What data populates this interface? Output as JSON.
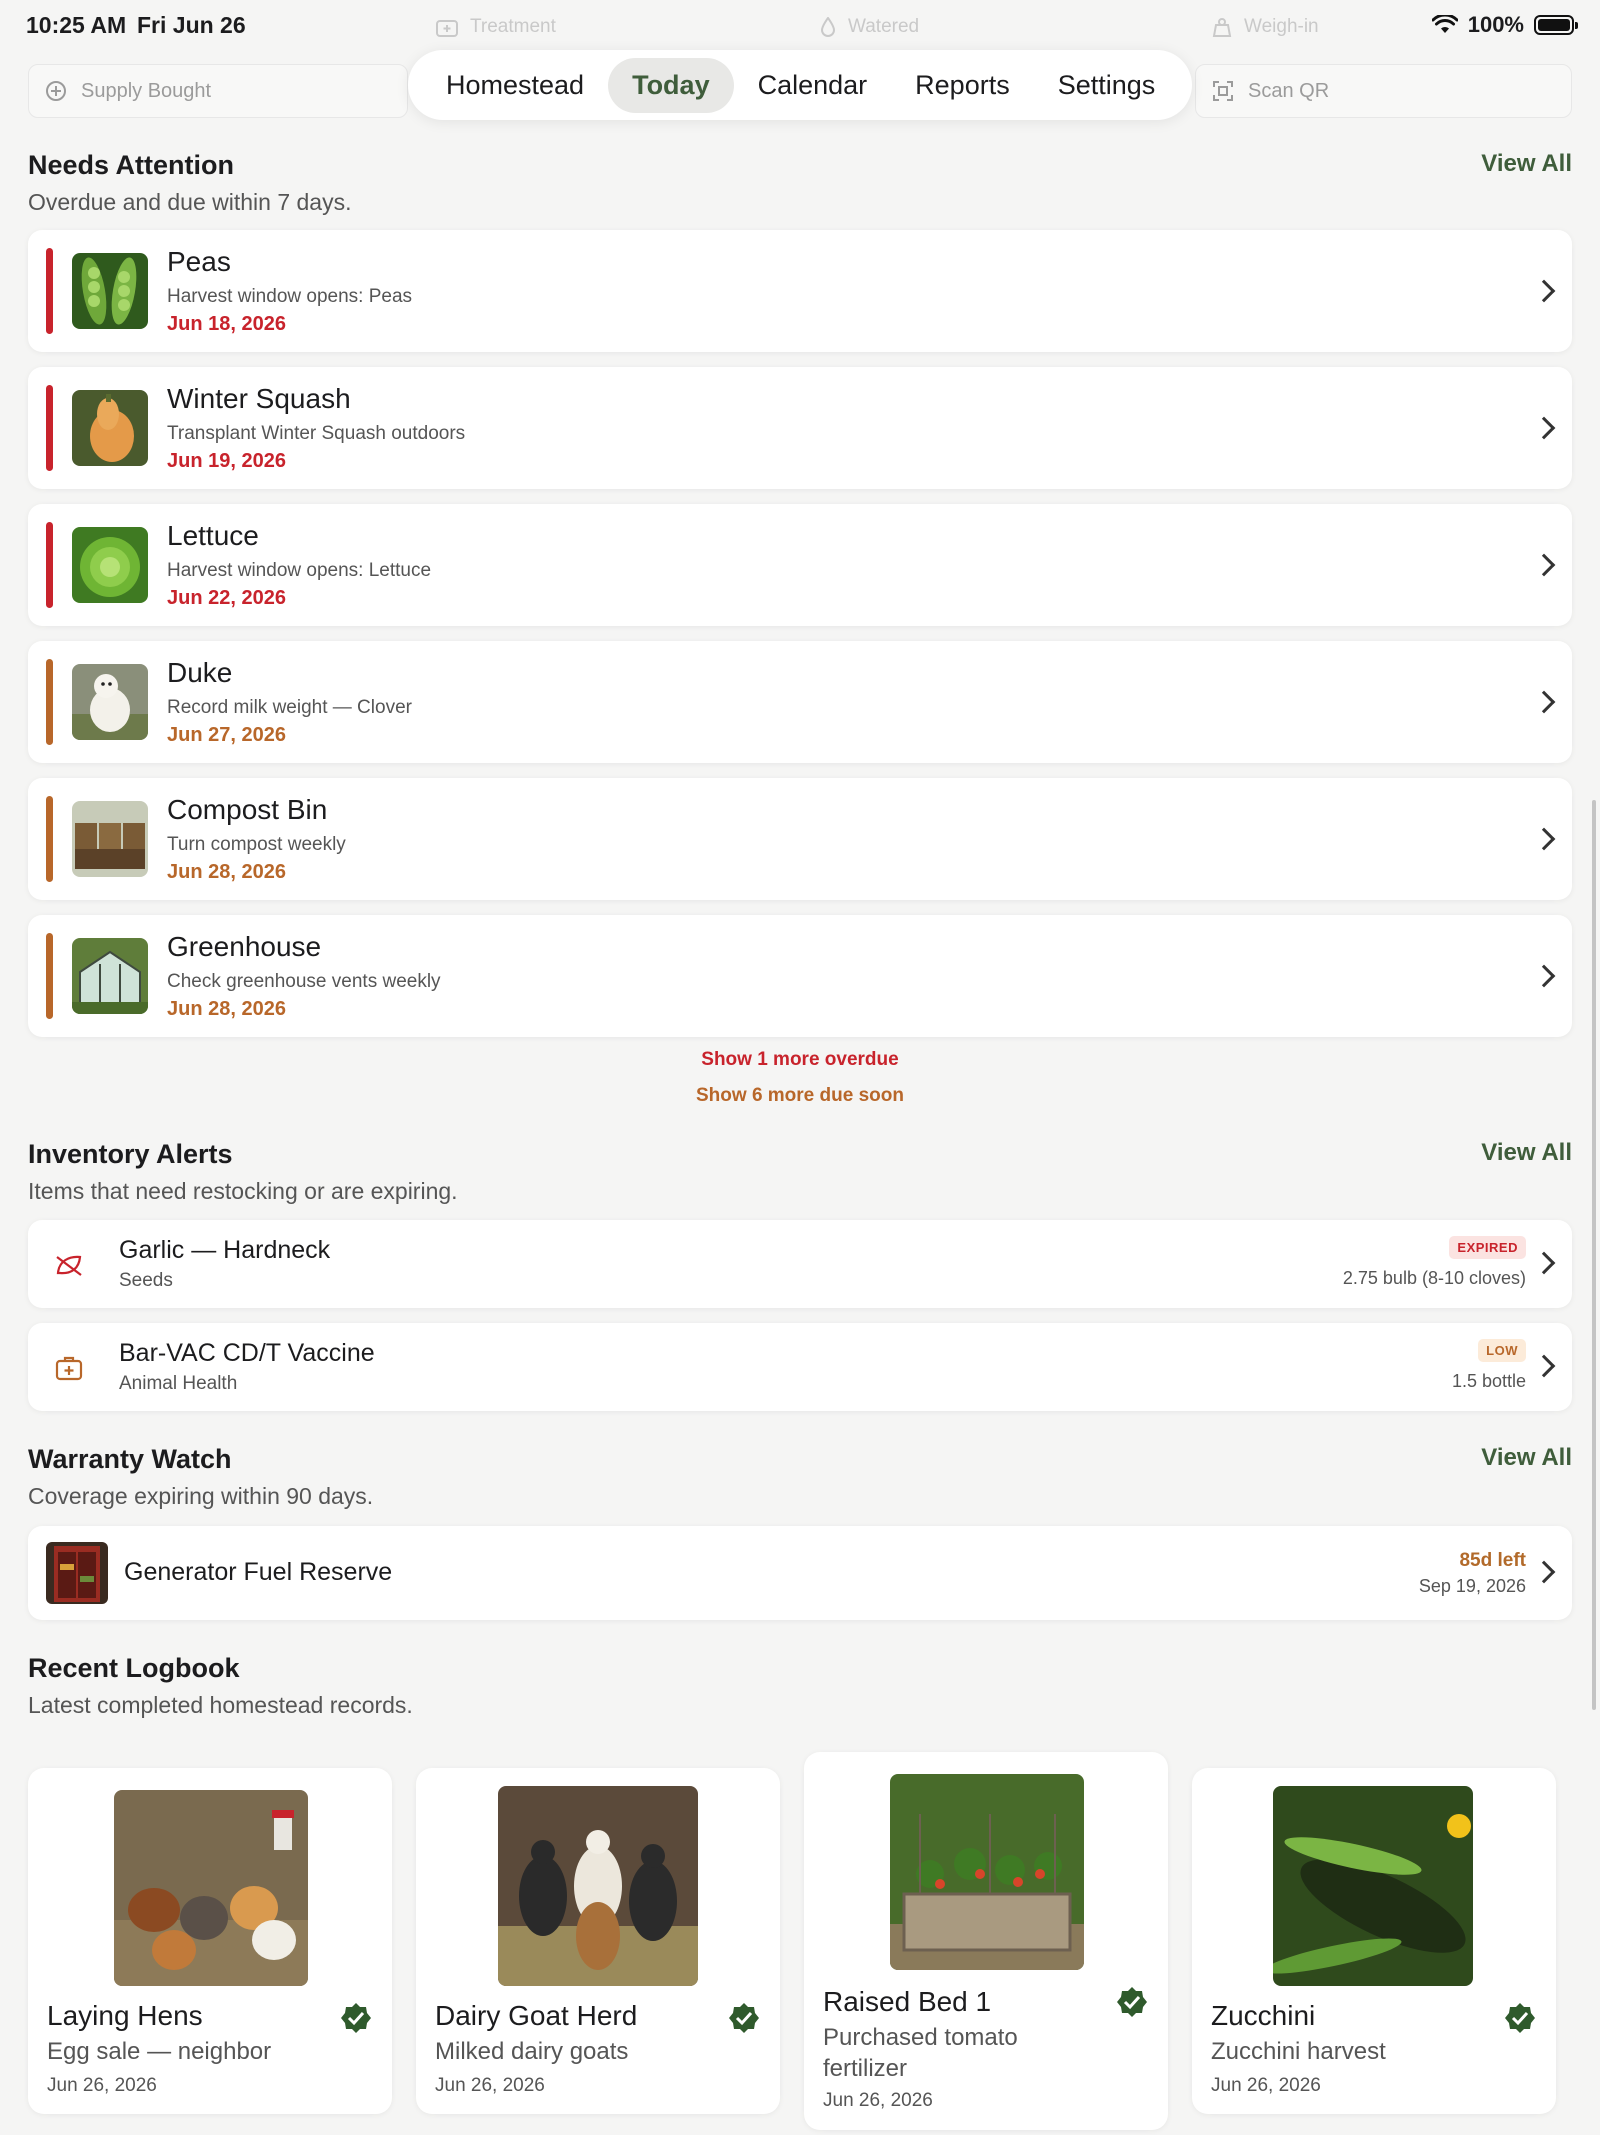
{
  "status_bar": {
    "time": "10:25 AM",
    "date": "Fri Jun 26",
    "battery": "100%"
  },
  "quick_actions": {
    "supply_bought": "Supply Bought",
    "treatment": "Treatment",
    "watered": "Watered",
    "weigh_in": "Weigh-in",
    "scan_qr": "Scan QR"
  },
  "tabs": [
    "Homestead",
    "Today",
    "Calendar",
    "Reports",
    "Settings"
  ],
  "active_tab": "Today",
  "needs_attention": {
    "title": "Needs Attention",
    "subtitle": "Overdue and due within 7 days.",
    "view_all": "View All",
    "items": [
      {
        "name": "Peas",
        "desc": "Harvest window opens: Peas",
        "due": "Jun 18, 2026",
        "status": "overdue"
      },
      {
        "name": "Winter Squash",
        "desc": "Transplant Winter Squash outdoors",
        "due": "Jun 19, 2026",
        "status": "overdue"
      },
      {
        "name": "Lettuce",
        "desc": "Harvest window opens: Lettuce",
        "due": "Jun 22, 2026",
        "status": "overdue"
      },
      {
        "name": "Duke",
        "desc": "Record milk weight — Clover",
        "due": "Jun 27, 2026",
        "status": "due-soon"
      },
      {
        "name": "Compost Bin",
        "desc": "Turn compost weekly",
        "due": "Jun 28, 2026",
        "status": "due-soon"
      },
      {
        "name": "Greenhouse",
        "desc": "Check greenhouse vents weekly",
        "due": "Jun 28, 2026",
        "status": "due-soon"
      }
    ],
    "show_more_overdue": "Show 1 more overdue",
    "show_more_due": "Show 6 more due soon"
  },
  "inventory_alerts": {
    "title": "Inventory Alerts",
    "subtitle": "Items that need restocking or are expiring.",
    "view_all": "View All",
    "items": [
      {
        "name": "Garlic — Hardneck",
        "category": "Seeds",
        "badge": "EXPIRED",
        "qty": "2.75 bulb (8-10 cloves)",
        "icon": "seed-leaf-icon"
      },
      {
        "name": "Bar-VAC CD/T Vaccine",
        "category": "Animal Health",
        "badge": "LOW",
        "qty": "1.5 bottle",
        "icon": "medkit-icon"
      }
    ]
  },
  "warranty_watch": {
    "title": "Warranty Watch",
    "subtitle": "Coverage expiring within 90 days.",
    "view_all": "View All",
    "items": [
      {
        "name": "Generator Fuel Reserve",
        "left": "85d left",
        "date": "Sep 19, 2026"
      }
    ]
  },
  "recent_logbook": {
    "title": "Recent Logbook",
    "subtitle": "Latest completed homestead records.",
    "items": [
      {
        "title": "Laying Hens",
        "sub": "Egg sale — neighbor",
        "date": "Jun 26, 2026"
      },
      {
        "title": "Dairy Goat Herd",
        "sub": "Milked dairy goats",
        "date": "Jun 26, 2026"
      },
      {
        "title": "Raised Bed 1",
        "sub": "Purchased tomato fertilizer",
        "date": "Jun 26, 2026"
      },
      {
        "title": "Zucchini",
        "sub": "Zucchini harvest",
        "date": "Jun 26, 2026"
      }
    ]
  },
  "colors": {
    "overdue": "#c8232c",
    "due_soon": "#b8672a",
    "accent": "#3f5d3b",
    "expired_bg": "#fbe3e1",
    "low_bg": "#fcebd9"
  }
}
